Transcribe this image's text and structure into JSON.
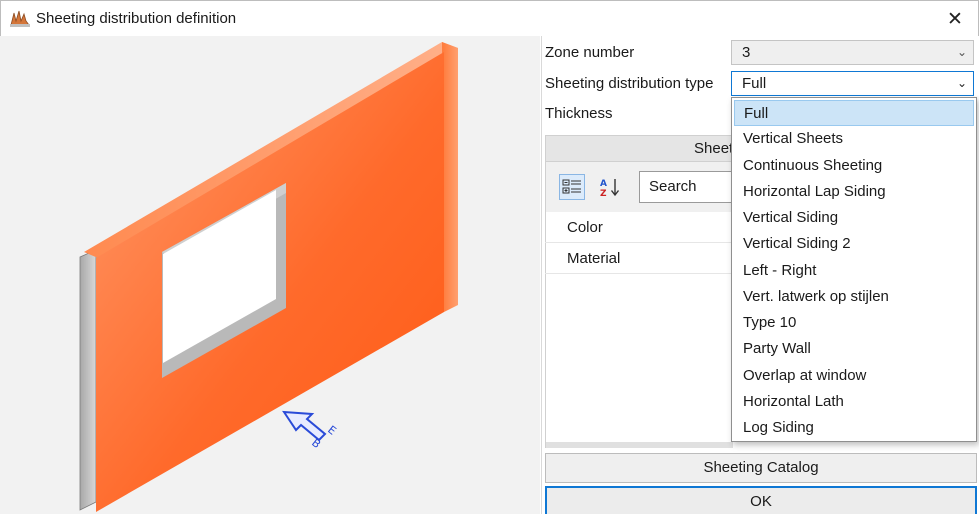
{
  "window": {
    "title": "Sheeting distribution definition",
    "close_glyph": "✕"
  },
  "properties": {
    "zone_number_label": "Zone number",
    "zone_number_value": "3",
    "distribution_type_label": "Sheeting distribution type",
    "distribution_type_value": "Full",
    "thickness_label": "Thickness"
  },
  "sheet_panel": {
    "header_label": "Sheet",
    "search_placeholder": "Search",
    "rows": [
      "Color",
      "Material"
    ]
  },
  "dropdown": {
    "selected_index": 0,
    "options": [
      "Full",
      "Vertical Sheets",
      "Continuous Sheeting",
      "Horizontal Lap Siding",
      "Vertical Siding",
      "Vertical Siding 2",
      "Left - Right",
      "Vert. latwerk op stijlen",
      "Type 10",
      "Party Wall",
      "Overlap at window",
      "Horizontal Lath",
      "Log Siding"
    ]
  },
  "buttons": {
    "catalog_label": "Sheeting Catalog",
    "ok_label": "OK"
  },
  "icons": {
    "app": "roof-app-icon",
    "categorized": "categorized-view-icon",
    "sort": "sort-az-icon",
    "direction": "direction-arrow-icon"
  },
  "colors": {
    "wall_orange": "#ff6a2b",
    "accent_blue": "#0f78d4",
    "selection": "#cce4f7"
  }
}
